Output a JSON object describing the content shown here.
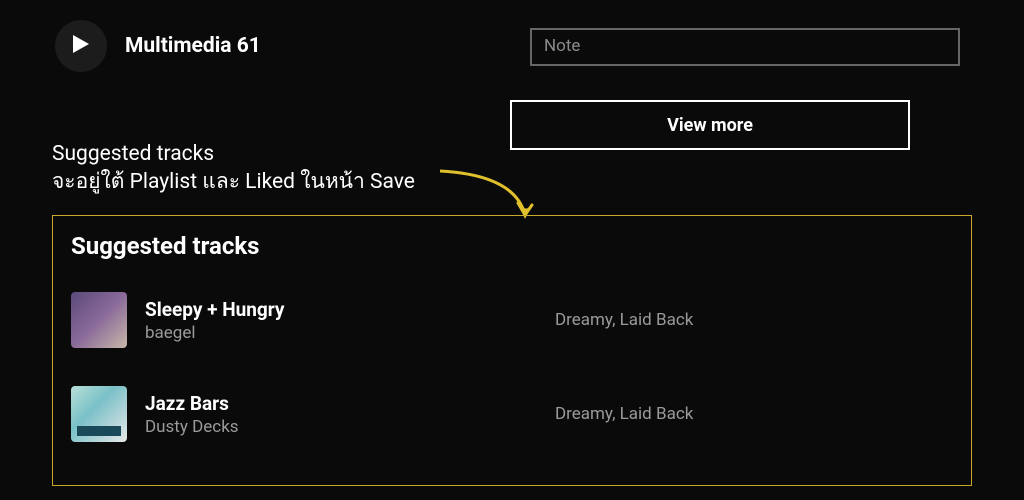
{
  "top": {
    "track_title": "Multimedia 61",
    "note_placeholder": "Note",
    "view_more": "View more"
  },
  "annotation": {
    "line1": "Suggested tracks",
    "line2": "จะอยู่ใต้ Playlist และ Liked ในหน้า Save"
  },
  "panel": {
    "title": "Suggested tracks",
    "tracks": [
      {
        "name": "Sleepy + Hungry",
        "artist": "baegel",
        "tags": "Dreamy, Laid Back"
      },
      {
        "name": "Jazz Bars",
        "artist": "Dusty Decks",
        "tags": "Dreamy, Laid Back"
      }
    ]
  }
}
